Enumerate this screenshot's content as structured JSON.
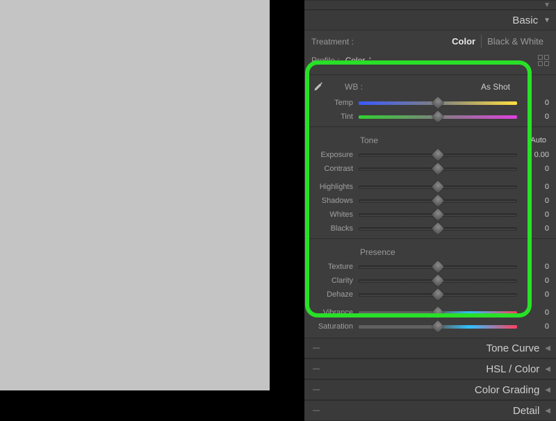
{
  "panels": {
    "basic": {
      "title": "Basic"
    },
    "tone_curve": {
      "title": "Tone Curve"
    },
    "hsl": {
      "title": "HSL / Color"
    },
    "color_grading": {
      "title": "Color Grading"
    },
    "detail": {
      "title": "Detail"
    }
  },
  "treatment": {
    "label": "Treatment :",
    "color": "Color",
    "bw": "Black & White"
  },
  "profile": {
    "label": "Profile :",
    "value": "Color"
  },
  "wb": {
    "label": "WB :",
    "value": "As Shot"
  },
  "sliders": {
    "temp": {
      "label": "Temp",
      "value": "0"
    },
    "tint": {
      "label": "Tint",
      "value": "0"
    },
    "exposure": {
      "label": "Exposure",
      "value": "0.00"
    },
    "contrast": {
      "label": "Contrast",
      "value": "0"
    },
    "highlights": {
      "label": "Highlights",
      "value": "0"
    },
    "shadows": {
      "label": "Shadows",
      "value": "0"
    },
    "whites": {
      "label": "Whites",
      "value": "0"
    },
    "blacks": {
      "label": "Blacks",
      "value": "0"
    },
    "texture": {
      "label": "Texture",
      "value": "0"
    },
    "clarity": {
      "label": "Clarity",
      "value": "0"
    },
    "dehaze": {
      "label": "Dehaze",
      "value": "0"
    },
    "vibrance": {
      "label": "Vibrance",
      "value": "0"
    },
    "saturation": {
      "label": "Saturation",
      "value": "0"
    }
  },
  "groups": {
    "tone": {
      "title": "Tone",
      "auto": "Auto"
    },
    "presence": {
      "title": "Presence"
    }
  }
}
